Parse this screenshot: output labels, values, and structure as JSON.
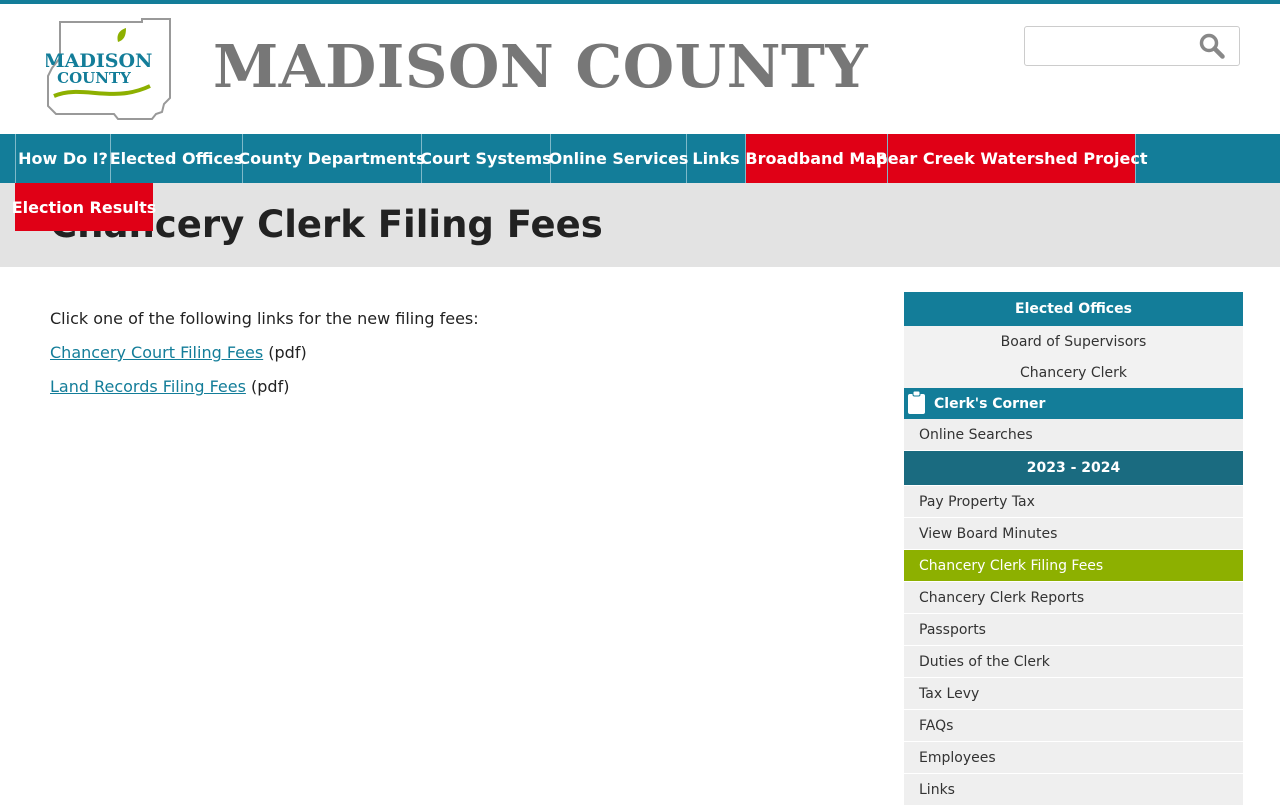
{
  "header": {
    "logo_text_line1": "MADISON",
    "logo_text_line2": "COUNTY",
    "site_title": "MADISON COUNTY",
    "search_placeholder": ""
  },
  "nav": {
    "items": [
      {
        "label": "How Do I?"
      },
      {
        "label": "Elected Offices"
      },
      {
        "label": "County Departments"
      },
      {
        "label": "Court Systems"
      },
      {
        "label": "Online Services"
      },
      {
        "label": "Links"
      },
      {
        "label": "Broadband Map"
      },
      {
        "label": "Bear Creek Watershed Project"
      },
      {
        "label": "Election Results"
      }
    ]
  },
  "page": {
    "title": "Chancery Clerk Filing Fees",
    "intro": "Click one of the following links for the new filing fees:",
    "links": [
      {
        "text": "Chancery Court Filing Fees",
        "suffix": " (pdf)"
      },
      {
        "text": "Land Records Filing Fees",
        "suffix": " (pdf)"
      }
    ]
  },
  "sidebar": {
    "header": "Elected Offices",
    "offices": [
      "Board of Supervisors",
      "Chancery Clerk"
    ],
    "corner_title": "Clerk's Corner",
    "online_searches": "Online Searches",
    "year": "2023 - 2024",
    "items": [
      {
        "label": "Pay Property Tax"
      },
      {
        "label": "View Board Minutes"
      },
      {
        "label": "Chancery Clerk Filing Fees"
      },
      {
        "label": "Chancery Clerk Reports"
      },
      {
        "label": "Passports"
      },
      {
        "label": "Duties of the Clerk"
      },
      {
        "label": "Tax Levy"
      },
      {
        "label": "FAQs"
      },
      {
        "label": "Employees"
      },
      {
        "label": "Links"
      }
    ]
  },
  "colors": {
    "brand_teal": "#137d99",
    "alert_red": "#e00016",
    "active_green": "#8db000",
    "year_teal": "#1a6b80"
  }
}
